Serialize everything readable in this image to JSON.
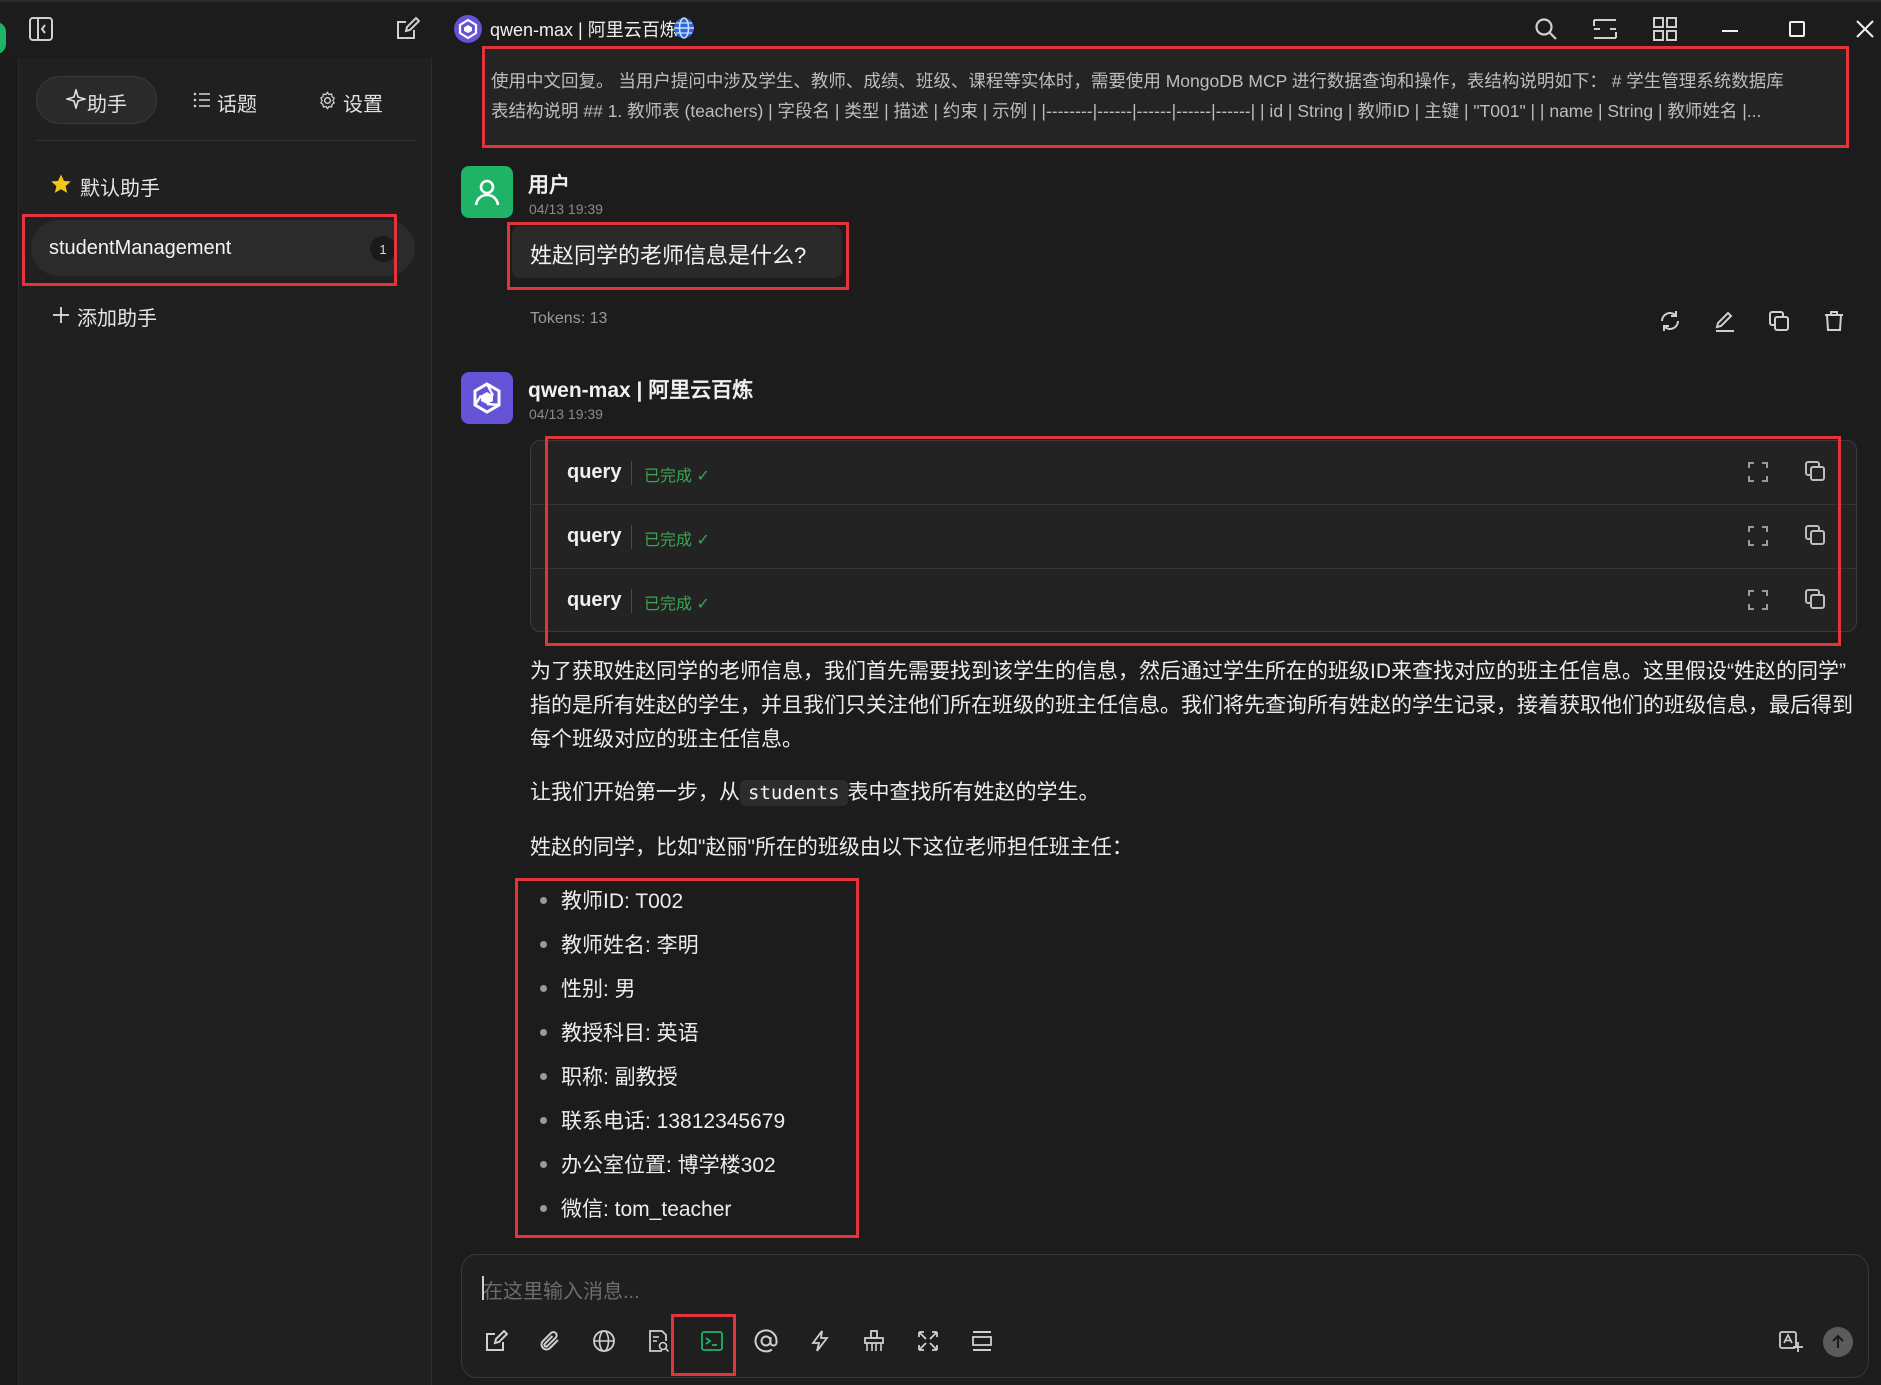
{
  "titlebar": {
    "model_title": "qwen-max | 阿里云百炼"
  },
  "sidebar": {
    "tabs": [
      {
        "label": "助手"
      },
      {
        "label": "话题"
      },
      {
        "label": "设置"
      }
    ],
    "assistants": [
      {
        "label": "默认助手"
      },
      {
        "label": "studentManagement",
        "badge": "1"
      }
    ],
    "add_label": "添加助手"
  },
  "prompt": {
    "line1": "使用中文回复。 当用户提问中涉及学生、教师、成绩、班级、课程等实体时，需要使用 MongoDB MCP 进行数据查询和操作，表结构说明如下： # 学生管理系统数据库",
    "line2": "表结构说明 ## 1. 教师表 (teachers) | 字段名 | 类型 | 描述 | 约束 | 示例 | |--------|------|------|------|------| | id | String | 教师ID | 主键 | \"T001\" | | name | String | 教师姓名 |..."
  },
  "user_message": {
    "name": "用户",
    "time": "04/13 19:39",
    "text": "姓赵同学的老师信息是什么?",
    "tokens": "Tokens: 13"
  },
  "assistant_message": {
    "name": "qwen-max | 阿里云百炼",
    "time": "04/13 19:39",
    "tool_calls": [
      {
        "name": "query",
        "status": "已完成 ✓"
      },
      {
        "name": "query",
        "status": "已完成 ✓"
      },
      {
        "name": "query",
        "status": "已完成 ✓"
      }
    ],
    "para1_l1": "为了获取姓赵同学的老师信息，我们首先需要找到该学生的信息，然后通过学生所在的班级ID来查找对应的班主任信息。这里假设“姓赵的同学”",
    "para1_l2": "指的是所有姓赵的学生，并且我们只关注他们所在班级的班主任信息。我们将先查询所有姓赵的学生记录，接着获取他们的班级信息，最后得到",
    "para1_l3": "每个班级对应的班主任信息。",
    "para2_pre": "让我们开始第一步，从",
    "para2_code": "students",
    "para2_post": "表中查找所有姓赵的学生。",
    "para3": "姓赵的同学，比如\"赵丽\"所在的班级由以下这位老师担任班主任：",
    "teacher_info": [
      "教师ID: T002",
      "教师姓名: 李明",
      "性别: 男",
      "教授科目: 英语",
      "职称: 副教授",
      "联系电话: 13812345679",
      "办公室位置: 博学楼302",
      "微信: tom_teacher"
    ]
  },
  "input": {
    "placeholder": "在这里输入消息..."
  },
  "colors": {
    "highlight": "#e5333b",
    "status_green": "#3aa655",
    "user_avatar": "#1eb367",
    "assistant_avatar": "#6453d6",
    "mcp_icon_active": "#1eb367"
  }
}
